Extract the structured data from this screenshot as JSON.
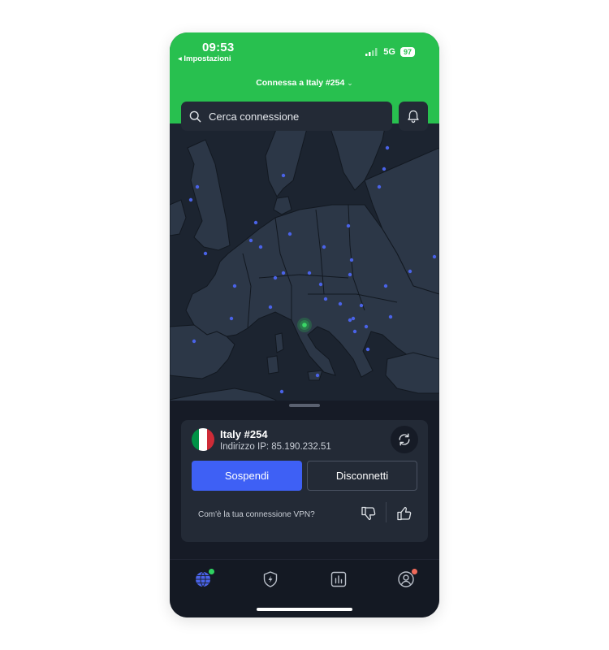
{
  "status_bar": {
    "time": "09:53",
    "back_label": "◂ Impostazioni",
    "network": "5G",
    "battery": "97"
  },
  "header": {
    "title": "Connessa a Italy #254",
    "chevron": "⌄"
  },
  "search": {
    "placeholder": "Cerca connessione"
  },
  "connection": {
    "server": "Italy #254",
    "ip": "Indirizzo IP: 85.190.232.51",
    "pause_label": "Sospendi",
    "disconnect_label": "Disconnetti",
    "feedback_question": "Com'è la tua connessione VPN?"
  },
  "colors": {
    "accent_green": "#28c04f",
    "primary_blue": "#3e60f5",
    "badge_green": "#2fd160",
    "badge_red": "#f06a5a",
    "flag": [
      "#009246",
      "#ffffff",
      "#ce2b37"
    ]
  },
  "tabs": [
    {
      "icon": "globe-icon",
      "active": true
    },
    {
      "icon": "shield-lightning-icon",
      "active": false
    },
    {
      "icon": "stats-icon",
      "active": false
    },
    {
      "icon": "profile-icon",
      "active": false
    }
  ]
}
